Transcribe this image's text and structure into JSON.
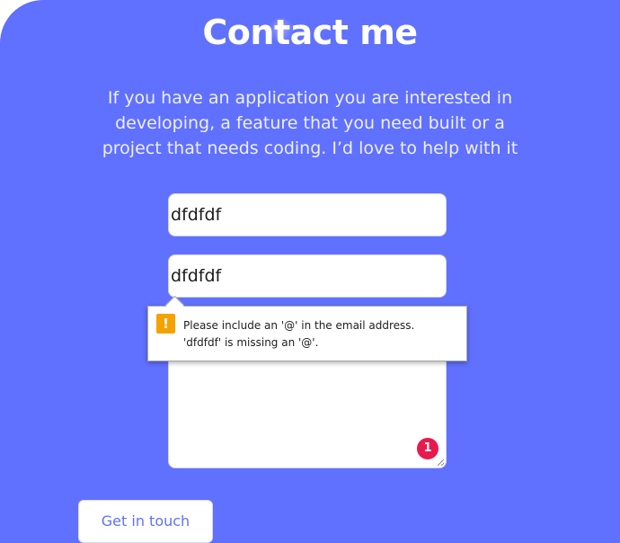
{
  "contact": {
    "title": "Contact me",
    "intro": "If you have an application you are interested in developing, a feature that you need built or a project that needs coding. I’d love to help with it"
  },
  "form": {
    "name_value": "dfdfdf",
    "email_value": "dfdfdf",
    "message_value": "",
    "submit_label": "Get in touch"
  },
  "validation": {
    "icon": "warning-icon",
    "icon_glyph": "!",
    "line1": "Please include an '@' in the email address.",
    "line2": "'dfdfdf' is missing an '@'."
  },
  "badge": {
    "count": "1"
  },
  "colors": {
    "section_background": "#6070ff",
    "accent": "#6070ff",
    "warning": "#f5a200",
    "badge": "#e8194d"
  }
}
